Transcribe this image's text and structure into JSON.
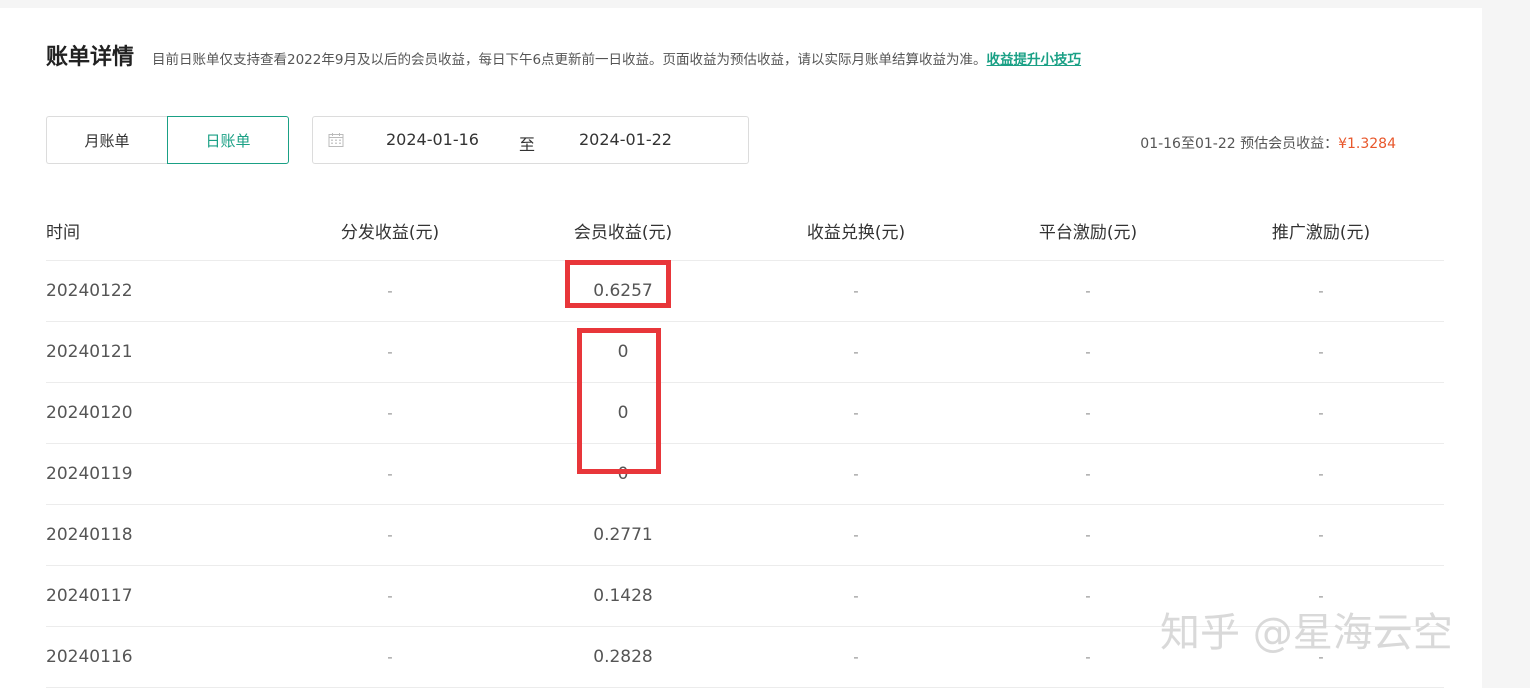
{
  "header": {
    "title": "账单详情",
    "notice": "目前日账单仅支持查看2022年9月及以后的会员收益，每日下午6点更新前一日收益。页面收益为预估收益，请以实际月账单结算收益为准。",
    "tips_link": "收益提升小技巧"
  },
  "tabs": [
    {
      "label": "月账单",
      "active": false
    },
    {
      "label": "日账单",
      "active": true
    }
  ],
  "date_range": {
    "icon": "calendar-icon",
    "start": "2024-01-16",
    "separator": "至",
    "end": "2024-01-22"
  },
  "summary": {
    "label": "01-16至01-22 预估会员收益：",
    "amount": "¥1.3284"
  },
  "table": {
    "columns": [
      "时间",
      "分发收益(元)",
      "会员收益(元)",
      "收益兑换(元)",
      "平台激励(元)",
      "推广激励(元)"
    ],
    "rows": [
      [
        "20240122",
        "-",
        "0.6257",
        "-",
        "-",
        "-"
      ],
      [
        "20240121",
        "-",
        "0",
        "-",
        "-",
        "-"
      ],
      [
        "20240120",
        "-",
        "0",
        "-",
        "-",
        "-"
      ],
      [
        "20240119",
        "-",
        "0",
        "-",
        "-",
        "-"
      ],
      [
        "20240118",
        "-",
        "0.2771",
        "-",
        "-",
        "-"
      ],
      [
        "20240117",
        "-",
        "0.1428",
        "-",
        "-",
        "-"
      ],
      [
        "20240116",
        "-",
        "0.2828",
        "-",
        "-",
        "-"
      ]
    ]
  },
  "watermark": "知乎 @星海云空",
  "colors": {
    "accent": "#1aa085",
    "amount": "#e8572b",
    "highlight": "#e8363a"
  }
}
